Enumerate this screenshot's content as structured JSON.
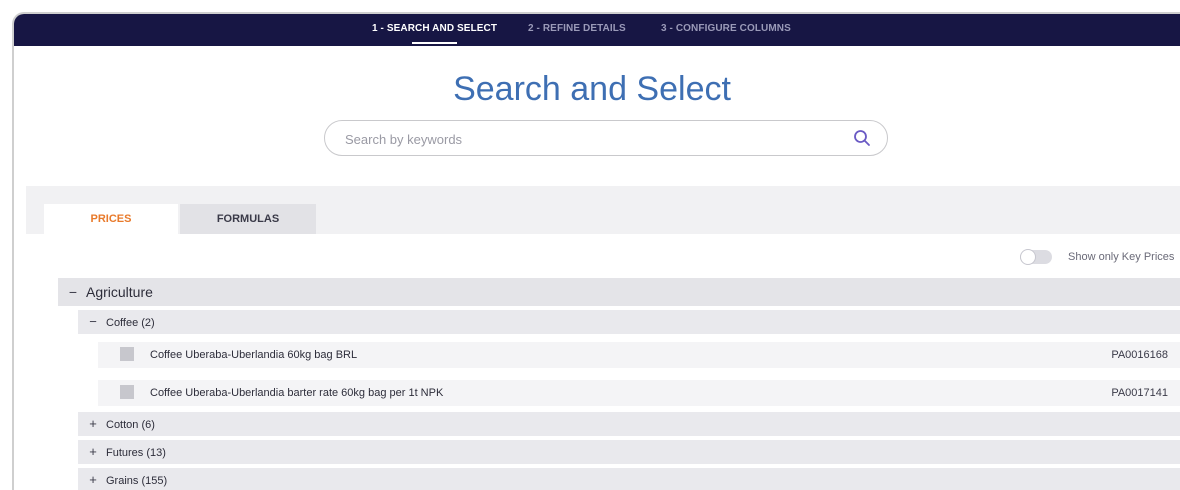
{
  "wizard": {
    "steps": [
      {
        "label": "1 - SEARCH AND SELECT",
        "active": true
      },
      {
        "label": "2 - REFINE DETAILS",
        "active": false
      },
      {
        "label": "3 - CONFIGURE COLUMNS",
        "active": false
      }
    ],
    "close_icon": "close-icon"
  },
  "page": {
    "title": "Search and Select"
  },
  "search": {
    "placeholder": "Search by keywords",
    "value": "",
    "icon": "search-icon"
  },
  "tabs": [
    {
      "label": "PRICES",
      "active": true
    },
    {
      "label": "FORMULAS",
      "active": false
    }
  ],
  "filter": {
    "toggle_label": "Show only Key Prices",
    "enabled": false
  },
  "tree": {
    "category": {
      "label": "Agriculture",
      "expanded": true,
      "sign": "−"
    },
    "groups": [
      {
        "label": "Coffee (2)",
        "sign": "−",
        "expanded": true,
        "items": [
          {
            "label": "Coffee Uberaba-Uberlandia 60kg bag BRL",
            "code": "PA0016168"
          },
          {
            "label": "Coffee Uberaba-Uberlandia barter rate 60kg bag per 1t NPK",
            "code": "PA0017141"
          }
        ]
      },
      {
        "label": "Cotton (6)",
        "sign": "+",
        "expanded": false
      },
      {
        "label": "Futures (13)",
        "sign": "+",
        "expanded": false
      },
      {
        "label": "Grains (155)",
        "sign": "+",
        "expanded": false
      }
    ]
  },
  "colors": {
    "topbar": "#171644",
    "title": "#3e6fb3",
    "active_tab": "#e87a2b"
  }
}
